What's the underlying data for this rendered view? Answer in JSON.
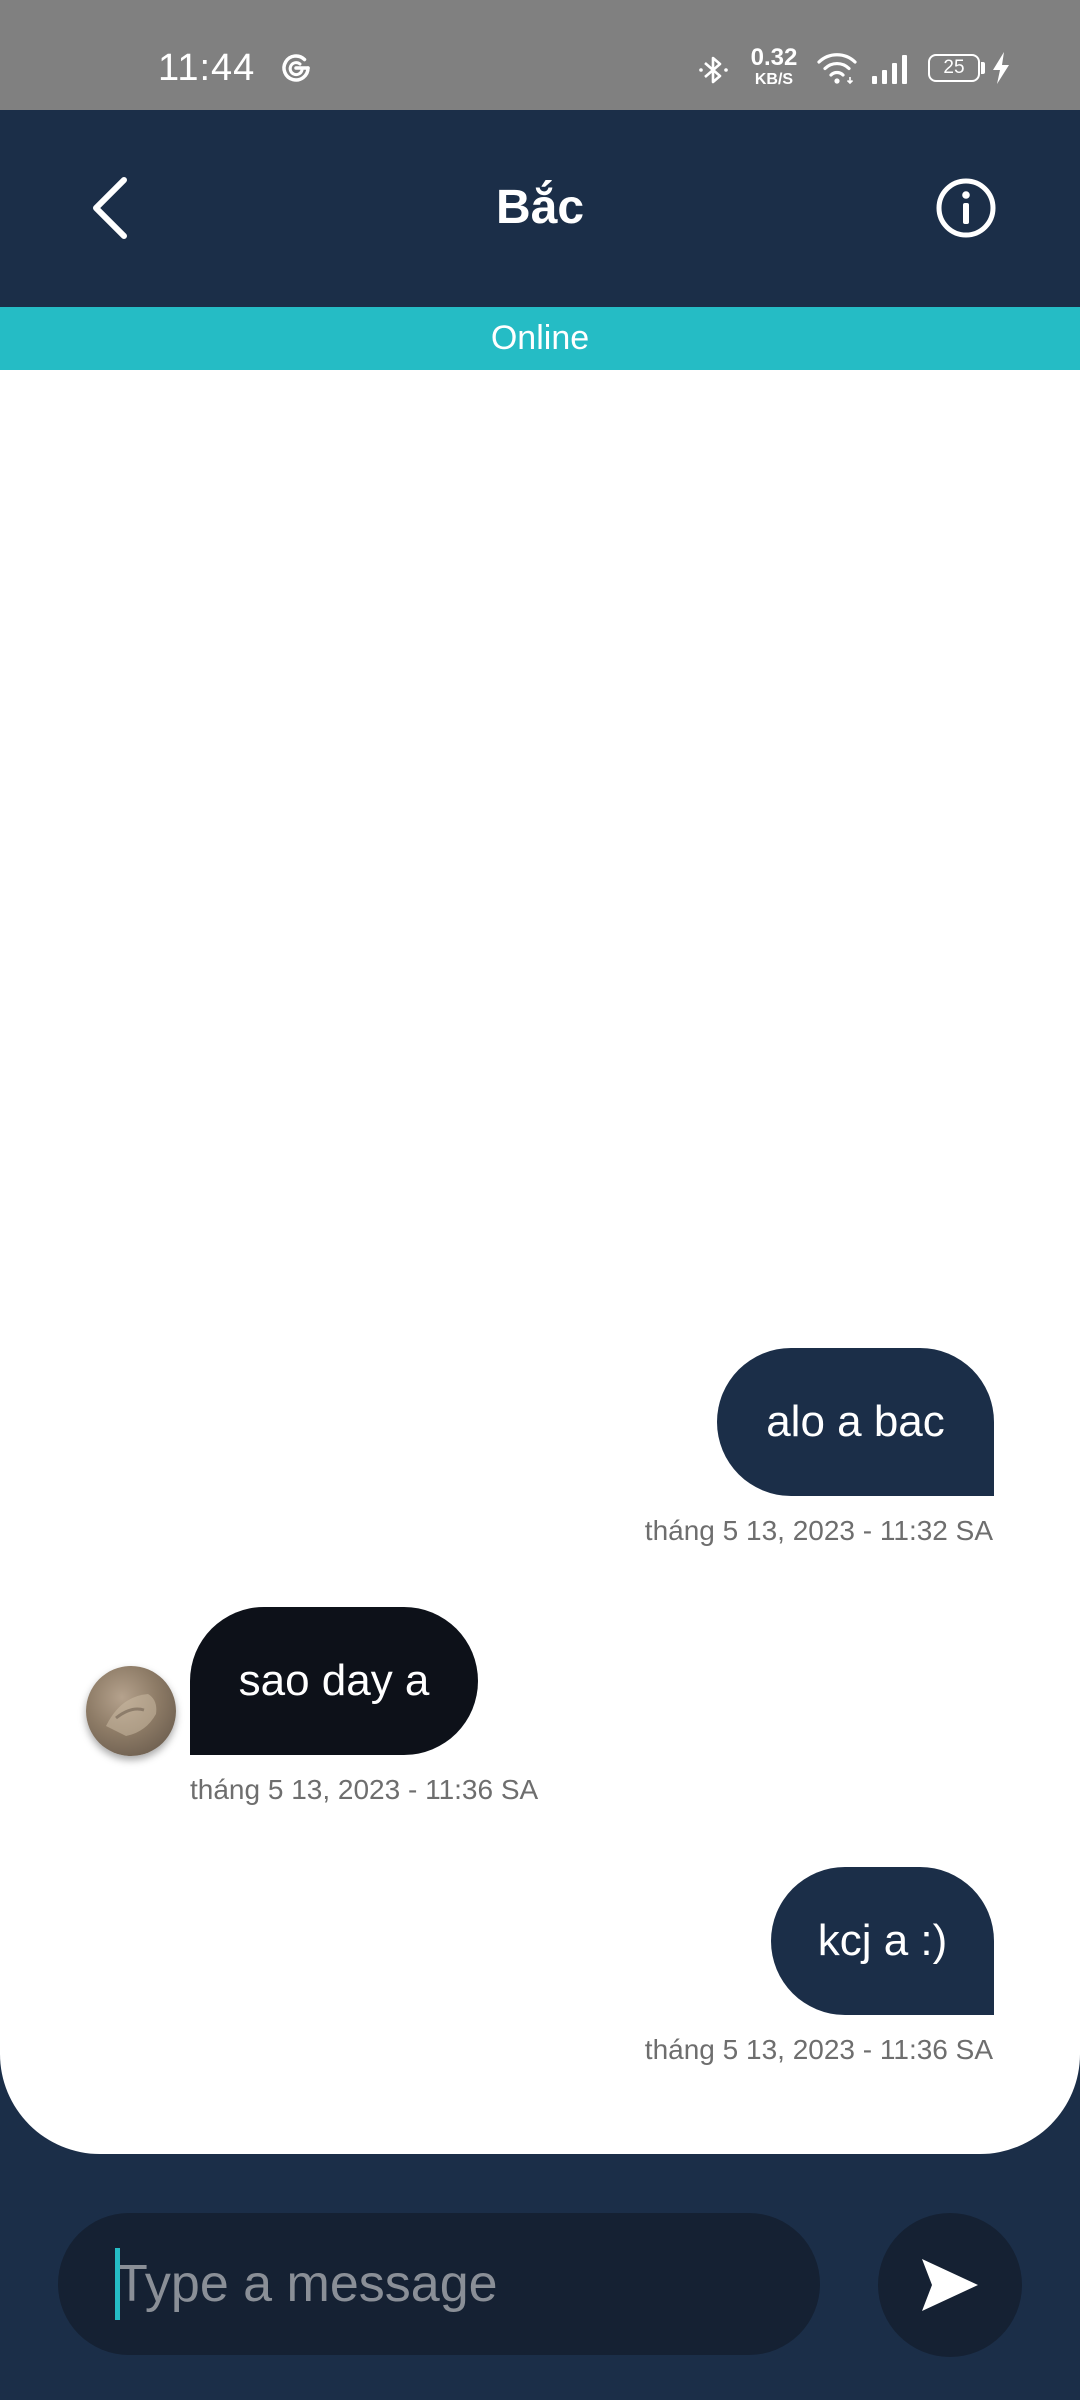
{
  "status_bar": {
    "time": "11:44",
    "network_speed_value": "0.32",
    "network_speed_unit": "KB/S",
    "battery_level": "25"
  },
  "header": {
    "title": "Bắc",
    "back_icon": "chevron-left-icon",
    "info_icon": "info-circle-icon"
  },
  "presence_status": "Online",
  "messages": [
    {
      "direction": "sent",
      "text": "alo a bac",
      "timestamp": "tháng 5 13, 2023 - 11:32 SA"
    },
    {
      "direction": "received",
      "text": "sao day a",
      "timestamp": "tháng 5 13, 2023 - 11:36 SA"
    },
    {
      "direction": "sent",
      "text": "kcj a :)",
      "timestamp": "tháng 5 13, 2023 - 11:36 SA"
    }
  ],
  "composer": {
    "placeholder": "Type a message",
    "value": "",
    "send_icon": "send-icon"
  },
  "colors": {
    "primary": "#1b2e48",
    "accent": "#25bcc5",
    "received_bubble": "#0d1119",
    "status_bar": "#808080"
  }
}
